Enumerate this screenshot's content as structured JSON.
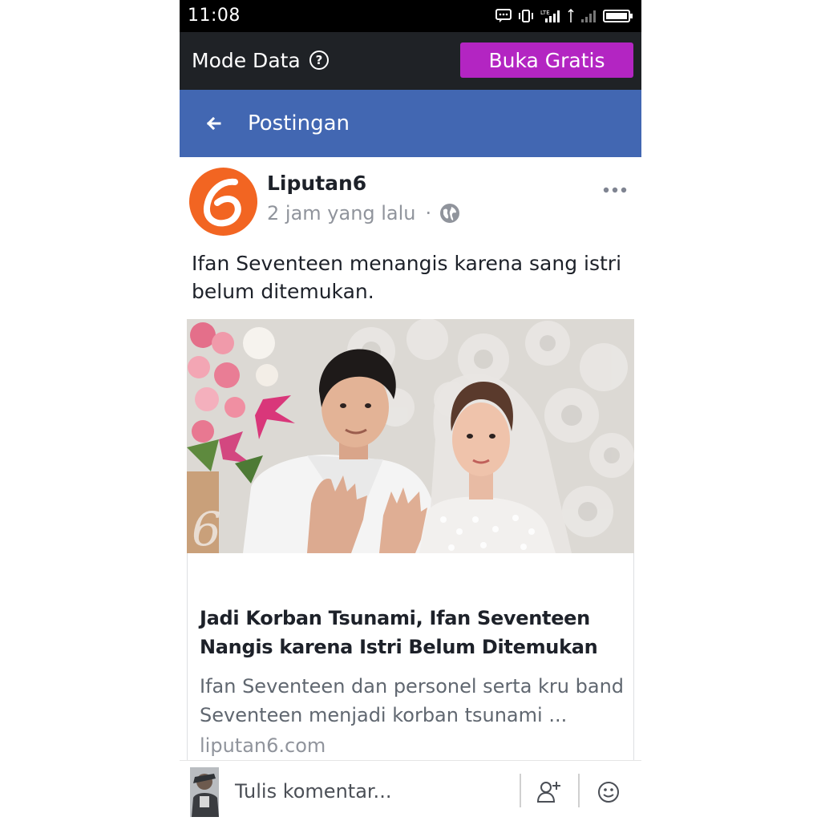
{
  "status_bar": {
    "time": "11:08",
    "icons": [
      "message-icon",
      "vibrate-icon",
      "lte-signal-icon",
      "signal-icon",
      "battery-icon"
    ]
  },
  "data_mode": {
    "title": "Mode Data",
    "help_symbol": "?",
    "free_button_label": "Buka Gratis",
    "free_button_color": "#b325c2"
  },
  "header": {
    "title": "Postingan",
    "background_color": "#4267b2"
  },
  "post": {
    "page_name": "Liputan6",
    "timestamp": "2 jam yang lalu",
    "separator": "·",
    "privacy_icon": "globe-icon",
    "text": "Ifan Seventeen menangis karena sang istri belum ditemukan.",
    "avatar_color": "#f26522"
  },
  "link_card": {
    "title": "Jadi Korban Tsunami, Ifan Seventeen Nangis karena Istri Belum Ditemukan",
    "description": "Ifan Seventeen dan personel serta kru band Seventeen menjadi korban tsunami ...",
    "domain": "liputan6.com"
  },
  "comment_bar": {
    "placeholder": "Tulis komentar...",
    "icons": [
      "add-friend-icon",
      "emoji-icon"
    ]
  }
}
